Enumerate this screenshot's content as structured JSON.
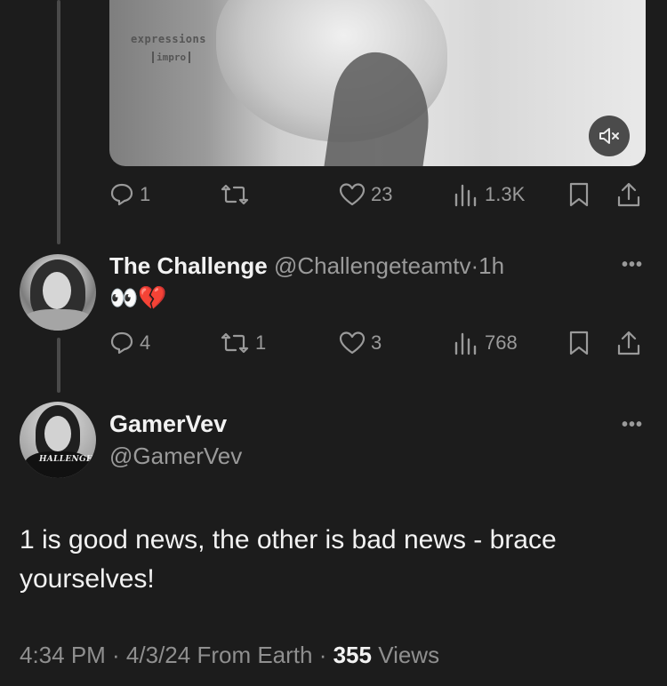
{
  "media": {
    "watermark_line1": "expressions",
    "watermark_line2": "impro",
    "mute_icon": "speaker-muted-icon"
  },
  "parent_actions": {
    "replies": "1",
    "reposts": "",
    "likes": "23",
    "views": "1.3K"
  },
  "reply": {
    "name": "The Challenge",
    "handle": "@Challengeteamtv",
    "separator": "·",
    "time": "1h",
    "text": "👀💔",
    "actions": {
      "replies": "4",
      "reposts": "1",
      "likes": "3",
      "views": "768"
    }
  },
  "main_tweet": {
    "name": "GamerVev",
    "handle": "@GamerVev",
    "avatar_shirt_text": "HALLENGE",
    "text": "1 is good news, the other is bad news - brace yourselves!",
    "meta_prefix": "4:34 PM · 4/3/24 From Earth · ",
    "views_count": "355",
    "views_label": " Views"
  },
  "icons": {
    "reply": "reply-bubble-icon",
    "repost": "repost-icon",
    "like": "heart-icon",
    "views": "views-bars-icon",
    "bookmark": "bookmark-icon",
    "share": "share-icon",
    "more": "more-dots-icon"
  }
}
